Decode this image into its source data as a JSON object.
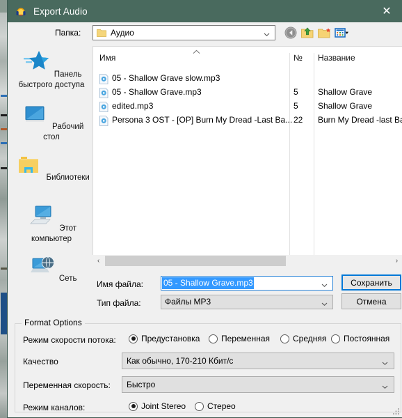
{
  "window": {
    "title": "Export Audio",
    "app_icon": "audacity-headphones-icon",
    "close_label": "✕",
    "titlebar_color": "#496a5e"
  },
  "lookin": {
    "label": "Папка:",
    "value": "Аудио",
    "toolbar": [
      {
        "name": "back-icon",
        "tooltip": "Назад"
      },
      {
        "name": "up-folder-icon",
        "tooltip": "Вверх"
      },
      {
        "name": "new-folder-icon",
        "tooltip": "Новая папка"
      },
      {
        "name": "view-menu-icon",
        "tooltip": "Вид"
      }
    ]
  },
  "places": [
    {
      "label": "Панель быстрого доступа",
      "icon": "star-icon"
    },
    {
      "label": "Рабочий стол",
      "icon": "desktop-icon"
    },
    {
      "label": "Библиотеки",
      "icon": "libraries-folder-icon"
    },
    {
      "label": "Этот компьютер",
      "icon": "this-pc-icon"
    },
    {
      "label": "Сеть",
      "icon": "network-icon"
    }
  ],
  "filelist": {
    "columns": [
      "Имя",
      "№",
      "Название"
    ],
    "sort_indicator": "ascending",
    "rows": [
      {
        "name": "05 - Shallow Grave slow.mp3",
        "num": "",
        "title": ""
      },
      {
        "name": "05 - Shallow Grave.mp3",
        "num": "5",
        "title": "Shallow Grave"
      },
      {
        "name": "edited.mp3",
        "num": "5",
        "title": "Shallow Grave"
      },
      {
        "name": "Persona 3 OST - [OP] Burn My Dread -Last Ba...",
        "num": "22",
        "title": "Burn My Dread -last Bat"
      }
    ]
  },
  "scrollbar": {
    "left_arrow": "‹",
    "right_arrow": "›"
  },
  "filename": {
    "label": "Имя файла:",
    "value": "05 - Shallow Grave.mp3",
    "selected": true,
    "selection_color": "#3399ff"
  },
  "filetype": {
    "label": "Тип файла:",
    "value": "Файлы MP3"
  },
  "buttons": {
    "save": "Сохранить",
    "cancel": "Отмена",
    "save_focus_color": "#0078d7"
  },
  "format_options": {
    "legend": "Format Options",
    "bitrate_mode": {
      "label": "Режим скорости потока:",
      "options": [
        "Предустановка",
        "Переменная",
        "Средняя",
        "Постоянная"
      ],
      "selected": 0
    },
    "quality": {
      "label": "Качество",
      "value": "Как обычно, 170-210 Кбит/с"
    },
    "variable_speed": {
      "label": "Переменная скорость:",
      "value": "Быстро"
    },
    "channel_mode": {
      "label": "Режим каналов:",
      "options": [
        "Joint Stereo",
        "Стерео"
      ],
      "selected": 0
    }
  }
}
